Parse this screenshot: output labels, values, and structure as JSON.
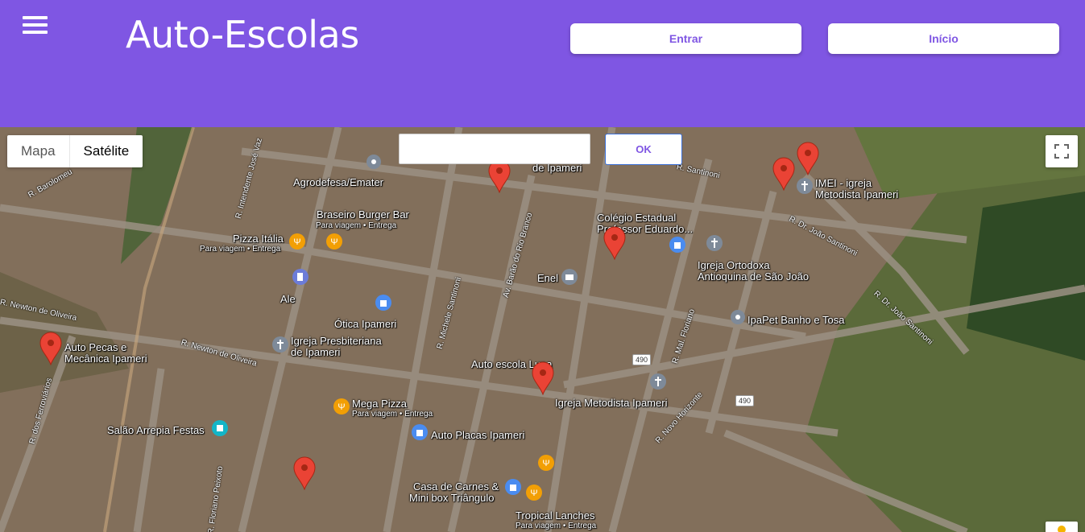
{
  "header": {
    "title": "Auto-Escolas",
    "login_label": "Entrar",
    "home_label": "Início",
    "color": "#7f56e3"
  },
  "map": {
    "type_map_label": "Mapa",
    "type_satellite_label": "Satélite",
    "search_placeholder": "",
    "ok_label": "OK",
    "places": [
      {
        "name": "Agrodefesa/Emater"
      },
      {
        "name": "Braseiro Burger Bar"
      },
      {
        "name": "Pizza Itália"
      },
      {
        "name": "de Ipameri"
      },
      {
        "name": "Colégio Estadual"
      },
      {
        "name": "Professor Eduardo..."
      },
      {
        "name": "IMEI - igreja"
      },
      {
        "name": "Metodista Ipameri"
      },
      {
        "name": "Igreja Ortodoxa"
      },
      {
        "name": "Antioquina de São João"
      },
      {
        "name": "Enel"
      },
      {
        "name": "Ale"
      },
      {
        "name": "Ótica Ipameri"
      },
      {
        "name": "Igreja Presbiteriana"
      },
      {
        "name": "de Ipameri"
      },
      {
        "name": "IpaPet Banho e Tosa"
      },
      {
        "name": "Auto Pecas e"
      },
      {
        "name": "Mecânica Ipameri"
      },
      {
        "name": "Auto escola Luna"
      },
      {
        "name": "Igreja Metodista Ipameri"
      },
      {
        "name": "Mega Pizza"
      },
      {
        "name": "Salão Arrepia Festas"
      },
      {
        "name": "Auto Placas Ipameri"
      },
      {
        "name": "Casa de Carnes &"
      },
      {
        "name": "Mini box Triângulo"
      },
      {
        "name": "Tropical Lanches"
      }
    ],
    "subtitles": {
      "takeaway": "Para viagem • Entrega"
    },
    "streets": [
      "R. Barolomeu",
      "R. Intendente José Vaz",
      "R. Newton de Oliveira",
      "R. Newton de Oliveira",
      "R. dos Ferroviários",
      "R. Floriano Peixoto",
      "R. Michele Santinoni",
      "Av. Barão do Rio Branco",
      "R. Mal. Floriano",
      "R. Dr. João Santinoni",
      "R. Dr. João Santinoni",
      "R. Novo Horizonte",
      "R. Santinoni"
    ],
    "highways": [
      "490",
      "490"
    ]
  }
}
